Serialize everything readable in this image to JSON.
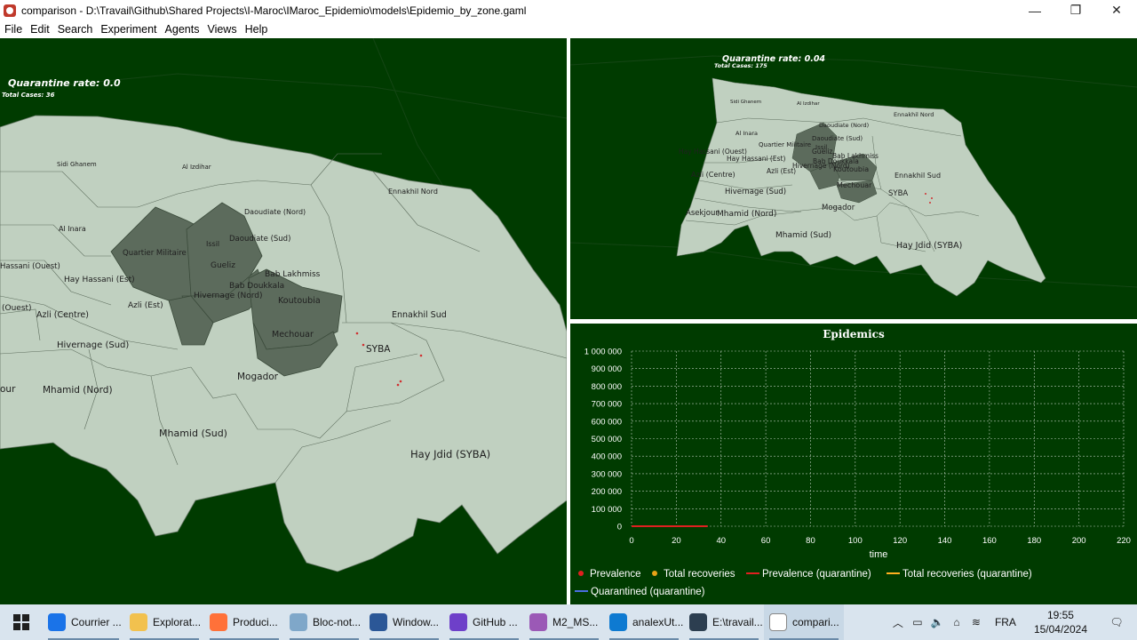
{
  "window": {
    "title": "comparison - D:\\Travail\\Github\\Shared Projects\\I-Maroc\\IMaroc_Epidemio\\models\\Epidemio_by_zone.gaml",
    "minimize": "—",
    "restore": "❐",
    "close": "✕"
  },
  "menu": [
    "File",
    "Edit",
    "Search",
    "Experiment",
    "Agents",
    "Views",
    "Help"
  ],
  "left_view": {
    "quarantine_label": "Quarantine rate: 0.0",
    "total_cases": "Total Cases: 36",
    "zones": [
      "Sidi Ghanem",
      "Al Izdihar",
      "Ennakhil Nord",
      "Daoudiate (Nord)",
      "Al Inara",
      "Quartier Militaire",
      "Issil",
      "Daoudiate (Sud)",
      "Hassani (Ouest)",
      "Gueliz",
      "Hay Hassani (Est)",
      "Bab Lakhmiss",
      "Bab Doukkala",
      "Hivernage (Nord)",
      "(Ouest)",
      "Azli (Est)",
      "Koutoubia",
      "Azli (Centre)",
      "Mechouar",
      "Ennakhil Sud",
      "Hivernage (Sud)",
      "SYBA",
      "Mogador",
      "our",
      "Mhamid (Nord)",
      "Mhamid (Sud)",
      "Hay Jdid (SYBA)"
    ]
  },
  "right_view": {
    "quarantine_label": "Quarantine rate: 0.04",
    "total_cases": "Total Cases: 175",
    "zones": [
      "Sidi Ghanem",
      "Al Izdihar",
      "Daoudiate (Nord)",
      "Ennakhil Nord",
      "Al Inara",
      "Daoudiate (Sud)",
      "Quartier Militaire",
      "Issil",
      "Gueliz",
      "Hay Hassani (Ouest)",
      "Hay Hassani (Est)",
      "Bab Lakhmiss",
      "Bab Doukkala",
      "Hivernage (Nord)",
      "Azli (Est)",
      "Koutoubia",
      "Azli (Centre)",
      "Ennakhil Sud",
      "Mechouar",
      "SYBA",
      "Hivernage (Sud)",
      "Mogador",
      "Asekjour",
      "Mhamid (Nord)",
      "Mhamid (Sud)",
      "Hay Jdid (SYBA)"
    ]
  },
  "chart_data": {
    "type": "line",
    "title": "Epidemics",
    "xlabel": "time",
    "ylabel": "",
    "xlim": [
      0,
      220
    ],
    "ylim": [
      0,
      1000000
    ],
    "xticks": [
      "0",
      "20",
      "40",
      "60",
      "80",
      "100",
      "120",
      "140",
      "160",
      "180",
      "200",
      "220"
    ],
    "yticks": [
      "0",
      "100 000",
      "200 000",
      "300 000",
      "400 000",
      "500 000",
      "600 000",
      "700 000",
      "800 000",
      "900 000",
      "1 000 000"
    ],
    "grid": true,
    "legend_position": "bottom",
    "series": [
      {
        "name": "Prevalence",
        "color": "#e02020",
        "marker": "dot",
        "x": [],
        "y": []
      },
      {
        "name": "Total recoveries",
        "color": "#e8a317",
        "marker": "dot",
        "x": [],
        "y": []
      },
      {
        "name": "Prevalence (quarantine)",
        "color": "#e02020",
        "marker": "line",
        "x": [
          0,
          34
        ],
        "y": [
          0,
          0
        ]
      },
      {
        "name": "Total recoveries (quarantine)",
        "color": "#ffb020",
        "marker": "line",
        "x": [],
        "y": []
      },
      {
        "name": "Quarantined (quarantine)",
        "color": "#4a6ee0",
        "marker": "line",
        "x": [],
        "y": []
      }
    ]
  },
  "taskbar": {
    "items": [
      {
        "label": "Courrier ...",
        "icon": "mail-icon",
        "color": "#1a73e8"
      },
      {
        "label": "Explorat...",
        "icon": "folder-icon",
        "color": "#f2c14e"
      },
      {
        "label": "Produci...",
        "icon": "firefox-icon",
        "color": "#ff7139"
      },
      {
        "label": "Bloc-not...",
        "icon": "notepad-icon",
        "color": "#7fa7c9"
      },
      {
        "label": "Window...",
        "icon": "powershell-icon",
        "color": "#2b5797"
      },
      {
        "label": "GitHub ...",
        "icon": "github-icon",
        "color": "#6e40c9"
      },
      {
        "label": "M2_MS...",
        "icon": "pdf-icon",
        "color": "#9b59b6"
      },
      {
        "label": "analexUt...",
        "icon": "vscode-icon",
        "color": "#0e7ad1"
      },
      {
        "label": "E:\\travail...",
        "icon": "eclipse-icon",
        "color": "#2c3e50"
      },
      {
        "label": "compari...",
        "icon": "gama-icon",
        "color": "#ffffff"
      }
    ],
    "language": "FRA",
    "time": "19:55",
    "date": "15/04/2024"
  }
}
